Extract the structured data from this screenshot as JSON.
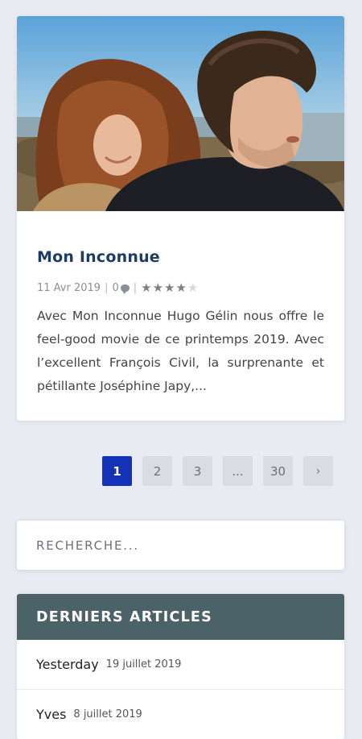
{
  "article": {
    "image_alt": "Photo du film Mon Inconnue",
    "title": "Mon Inconnue",
    "date": "11 Avr 2019",
    "comment_count": "0",
    "separator": "|",
    "rating": 4,
    "rating_max": 5,
    "excerpt": "Avec Mon Inconnue Hugo Gélin nous offre le feel-good movie de ce printemps 2019. Avec l’excellent François Civil, la surprenante et pétillante Joséphine Japy,..."
  },
  "pagination": {
    "pages": [
      "1",
      "2",
      "3",
      "...",
      "30"
    ],
    "active": "1",
    "next_label": "›"
  },
  "search": {
    "placeholder": "RECHERCHE..."
  },
  "recent_posts": {
    "title": "DERNIERS ARTICLES",
    "items": [
      {
        "name": "Yesterday",
        "date": "19 juillet 2019"
      },
      {
        "name": "Yves",
        "date": "8 juillet 2019"
      }
    ]
  },
  "colors": {
    "page_bg": "#e8ebf2",
    "title": "#1f3a63",
    "pagination_active": "#1432b8",
    "widget_header": "#4b6268"
  }
}
